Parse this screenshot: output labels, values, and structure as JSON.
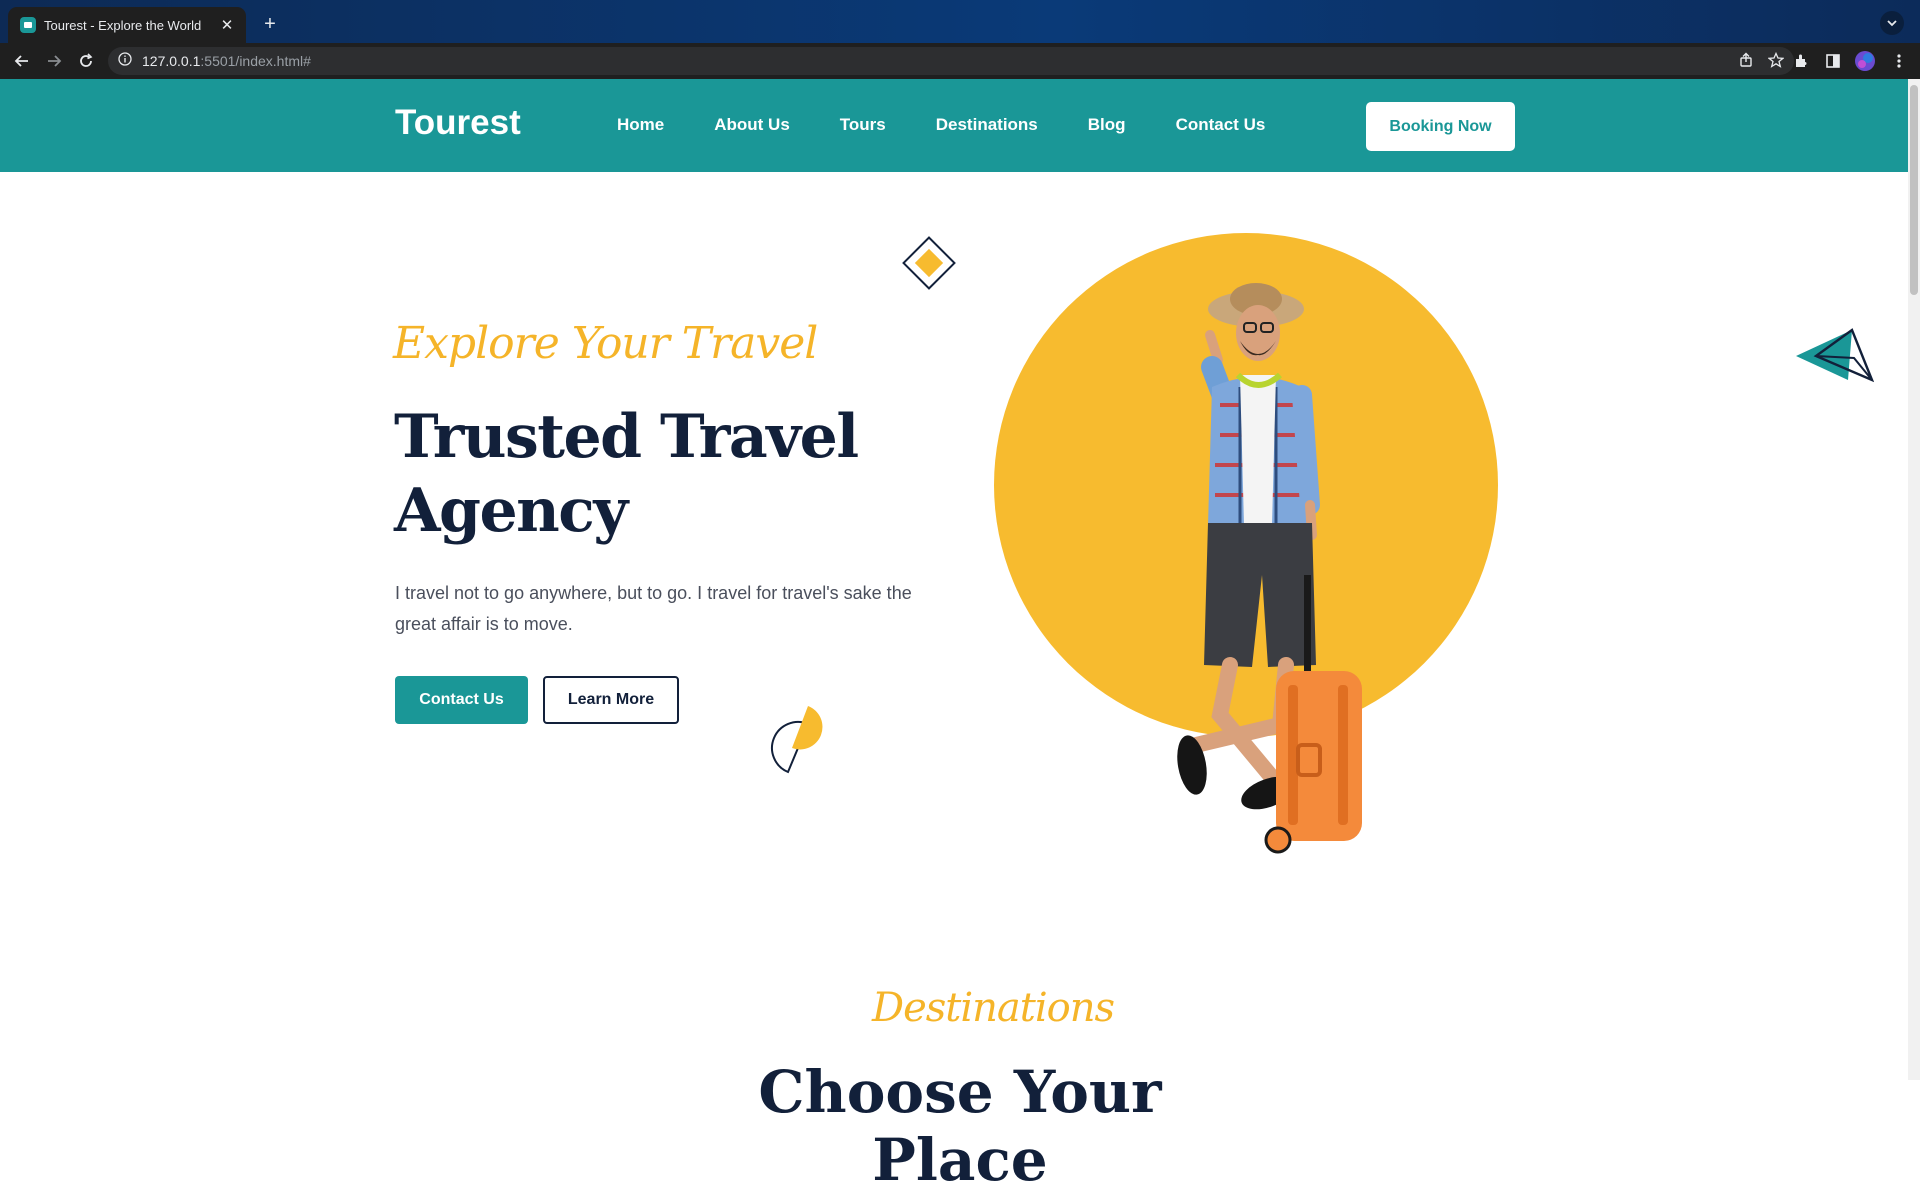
{
  "browser": {
    "tab_title": "Tourest - Explore the World",
    "url_host": "127.0.0.1",
    "url_path": ":5501/index.html#"
  },
  "site": {
    "logo": "Tourest",
    "nav": [
      "Home",
      "About Us",
      "Tours",
      "Destinations",
      "Blog",
      "Contact Us"
    ],
    "booking_button": "Booking Now"
  },
  "hero": {
    "subtitle": "Explore Your Travel",
    "title": "Trusted Travel Agency",
    "text": "I travel not to go anywhere, but to go. I travel for travel's sake the great affair is to move.",
    "primary_button": "Contact Us",
    "secondary_button": "Learn More"
  },
  "destinations": {
    "tag": "Destinations",
    "title": "Choose Your Place"
  },
  "colors": {
    "brand": "#1a9797",
    "accent": "#f7bb2f",
    "dark": "#12203a"
  }
}
